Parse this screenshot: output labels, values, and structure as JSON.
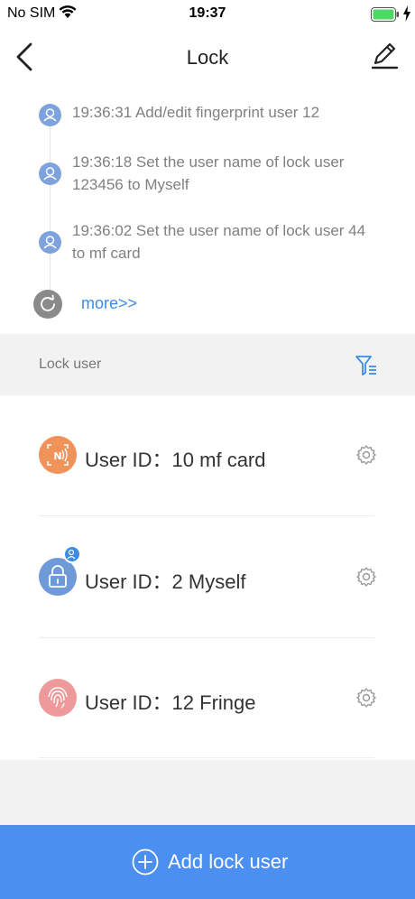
{
  "status_bar": {
    "carrier": "No SIM",
    "time": "19:37",
    "icons": [
      "wifi-icon",
      "battery-icon",
      "charging-icon"
    ],
    "battery_color": "#4cd964"
  },
  "nav": {
    "title": "Lock",
    "back_icon": "chevron-left-icon",
    "edit_icon": "pencil-icon"
  },
  "logs": {
    "items": [
      {
        "text": "19:36:31 Add/edit fingerprint user 12",
        "icon": "user-avatar-icon"
      },
      {
        "text": "19:36:18 Set the user name of lock user 123456 to Myself",
        "icon": "user-avatar-icon"
      },
      {
        "text": "19:36:02 Set the user name of lock user 44 to mf card",
        "icon": "user-avatar-icon"
      }
    ],
    "more_label": "more>>",
    "more_icon": "refresh-icon"
  },
  "lock_user_section": {
    "title": "Lock user",
    "filter_icon": "filter-icon"
  },
  "users": [
    {
      "label": "User ID：10   mf card",
      "icon": "nfc-card-icon",
      "color": "#f0935a"
    },
    {
      "label": "User ID：2   Myself",
      "icon": "padlock-icon",
      "color": "#6f9ad8"
    },
    {
      "label": "User ID：12   Fringe",
      "icon": "fingerprint-icon",
      "color": "#ef9a9a"
    }
  ],
  "add_button": {
    "label": "Add lock user",
    "icon": "plus-circle-icon",
    "color": "#4b8ff0"
  }
}
